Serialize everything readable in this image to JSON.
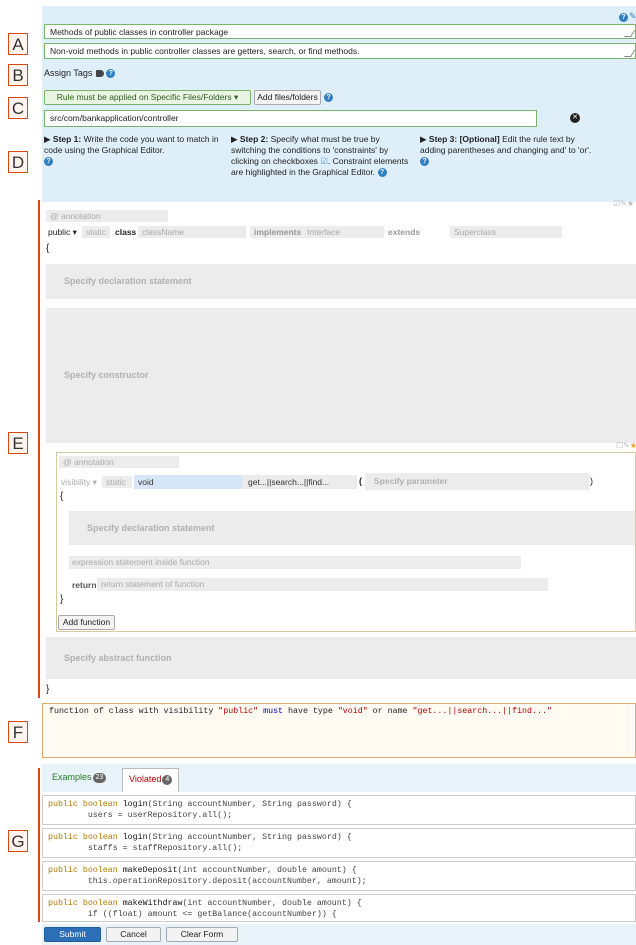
{
  "section_letters": [
    "A",
    "B",
    "C",
    "D",
    "E",
    "F",
    "G"
  ],
  "top_icons": {
    "help": "?",
    "edit": "pencil-icon"
  },
  "title_field": "Methods of public classes in controller package",
  "description_field": "Non-void methods in public controller classes are getters, search, or find methods.",
  "assign_tags": {
    "label": "Assign Tags"
  },
  "scope": {
    "selector": "Rule must be applied on Specific Files/Folders",
    "add_button": "Add files/folders",
    "path": "src/com/bankapplication/controller"
  },
  "steps": [
    {
      "title": "Step 1:",
      "text": "Write the code you want to match in code using the Graphical Editor."
    },
    {
      "title": "Step 2:",
      "text": "Specify what must be true by switching the conditions to 'constraints' by clicking on checkboxes",
      "text2": ". Constraint elements are highlighted in the Graphical Editor."
    },
    {
      "title": "Step 3: [Optional]",
      "text": "Edit the rule text by adding parentheses and changing and' to 'or'."
    }
  ],
  "editor": {
    "class_annotation": "@ annotation",
    "visibility": "public",
    "static": "static",
    "class_kw": "class",
    "class_name": "className",
    "implements_kw": "implements",
    "interface": "Interface",
    "extends_kw": "extends",
    "superclass": "Superclass",
    "open_brace": "{",
    "decl_stmt": "Specify declaration statement",
    "constructor": "Specify constructor",
    "fn_annotation": "@ annotation",
    "fn_visibility": "visibility",
    "fn_static": "static",
    "fn_type": "void",
    "fn_name": "get...||search...||find...",
    "fn_paren_open": "(",
    "fn_param": "Specify parameter",
    "fn_paren_close": ")",
    "fn_open_brace": "{",
    "fn_decl_stmt": "Specify declaration statement",
    "fn_expr": "expression statement inside function",
    "fn_return_kw": "return",
    "fn_return": "return statement of function",
    "fn_close_brace": "}",
    "add_function": "Add function",
    "abstract_fn": "Specify abstract function",
    "close_brace": "}"
  },
  "rule_text": {
    "p1": "function of class with visibility ",
    "s1": "\"public\"",
    "p2": " ",
    "must": "must",
    "p3": " have type ",
    "s2": "\"void\"",
    "p4": " or name ",
    "s3": "\"get...||search...||find...\""
  },
  "tabs": [
    {
      "label": "Examples",
      "count": "23"
    },
    {
      "label": "Violated",
      "count": "4"
    }
  ],
  "code_snippets": [
    {
      "l1a": "public boolean ",
      "l1b": "login",
      "l1c": "(String accountNumber, String password) {",
      "l2": "        users = userRepository.all();"
    },
    {
      "l1a": "public boolean ",
      "l1b": "login",
      "l1c": "(String accountNumber, String password) {",
      "l2": "        staffs = staffRepository.all();"
    },
    {
      "l1a": "public boolean ",
      "l1b": "makeDeposit",
      "l1c": "(int accountNumber, double amount) {",
      "l2": "        this.operationRepository.deposit(accountNumber, amount);"
    },
    {
      "l1a": "public boolean ",
      "l1b": "makeWithdraw",
      "l1c": "(int accountNumber, double amount) {",
      "l2": "        if ((float) amount <= getBalance(accountNumber)) {"
    }
  ],
  "buttons": {
    "submit": "Submit",
    "cancel": "Cancel",
    "clear": "Clear Form"
  },
  "colors": {
    "accent": "#d9480f",
    "panel": "#dfeff9",
    "submit": "#2c6fb6"
  }
}
